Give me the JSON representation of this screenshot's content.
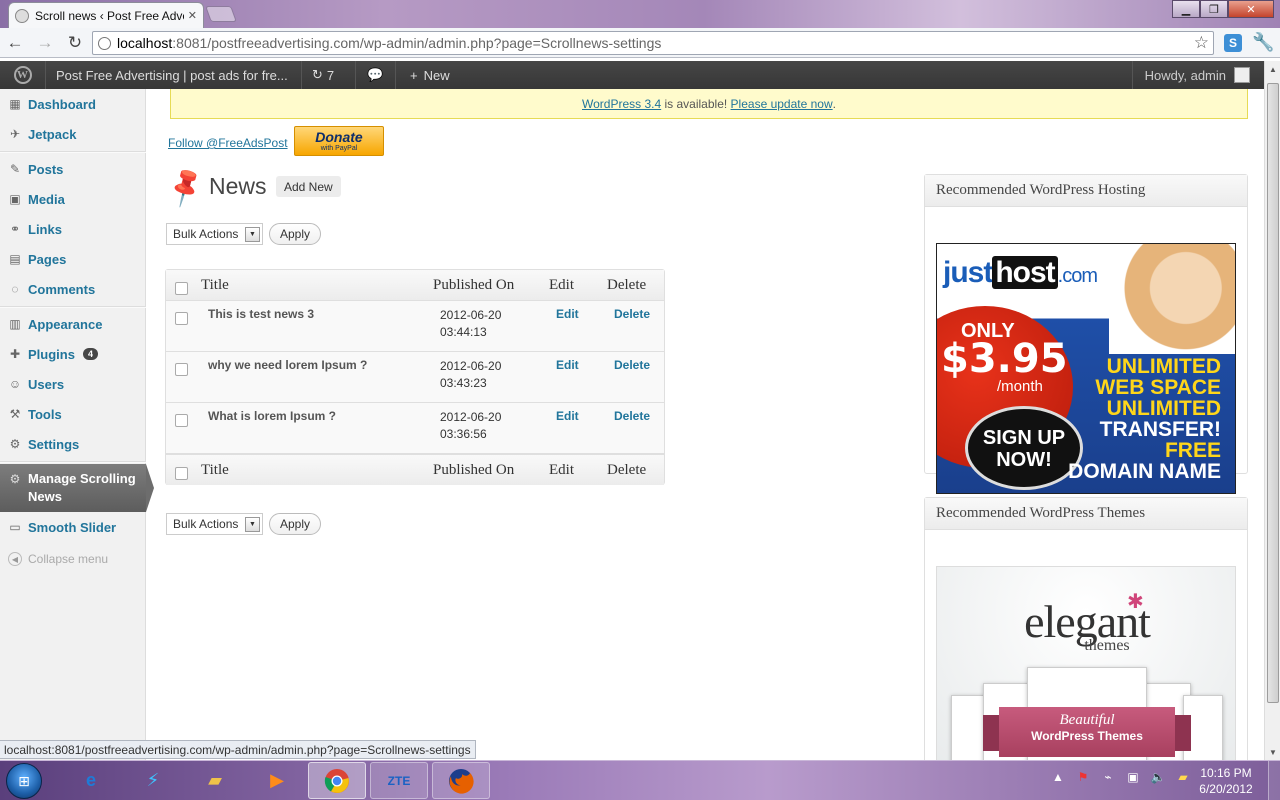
{
  "browser": {
    "tab_title": "Scroll news ‹ Post Free Adve",
    "url_host": "localhost",
    "url_rest": ":8081/postfreeadvertising.com/wp-admin/admin.php?page=Scrollnews-settings",
    "status_url": "localhost:8081/postfreeadvertising.com/wp-admin/admin.php?page=Scrollnews-settings"
  },
  "adminbar": {
    "site_name": "Post Free Advertising | post ads for fre...",
    "updates_count": "7",
    "new_label": "New",
    "howdy": "Howdy, admin"
  },
  "sidebar": {
    "dashboard": "Dashboard",
    "jetpack": "Jetpack",
    "posts": "Posts",
    "media": "Media",
    "links": "Links",
    "pages": "Pages",
    "comments": "Comments",
    "appearance": "Appearance",
    "plugins": "Plugins",
    "plugins_badge": "4",
    "users": "Users",
    "tools": "Tools",
    "settings": "Settings",
    "manage_scrolling": "Manage Scrolling News",
    "smooth_slider": "Smooth Slider",
    "collapse": "Collapse menu"
  },
  "notice": {
    "update_link": "WordPress 3.4",
    "middle": " is available! ",
    "please_update": "Please update now",
    "end": "."
  },
  "follow_link": "Follow @FreeAdsPost",
  "donate": {
    "line1": "Donate",
    "line2": "with PayPal"
  },
  "page": {
    "heading": "News",
    "add_new": "Add New"
  },
  "bulk": {
    "label": "Bulk Actions",
    "apply": "Apply"
  },
  "table": {
    "columns": {
      "title": "Title",
      "published": "Published On",
      "edit": "Edit",
      "delete": "Delete"
    },
    "rows": [
      {
        "title": "This is test news 3",
        "date": "2012-06-20",
        "time": "03:44:13",
        "edit": "Edit",
        "delete": "Delete"
      },
      {
        "title": "why we need lorem Ipsum ?",
        "date": "2012-06-20",
        "time": "03:43:23",
        "edit": "Edit",
        "delete": "Delete"
      },
      {
        "title": "What is lorem Ipsum ?",
        "date": "2012-06-20",
        "time": "03:36:56",
        "edit": "Edit",
        "delete": "Delete"
      }
    ]
  },
  "widgets": {
    "hosting": {
      "title": "Recommended WordPress Hosting",
      "brand_just": "just",
      "brand_host": "host",
      "brand_com": ".com",
      "only": "ONLY",
      "price": "$3.95",
      "per_month": "/month",
      "sign_up": "SIGN UP",
      "now": "NOW!",
      "unlimited1": "UNLIMITED",
      "web_space": "WEB SPACE",
      "unlimited2": "UNLIMITED",
      "transfer": "TRANSFER!",
      "free": "FREE",
      "domain_name": "DOMAIN NAME"
    },
    "themes": {
      "title": "Recommended WordPress Themes",
      "brand": "elegant",
      "sub": "themes",
      "ribbon1": "Beautiful",
      "ribbon2": "WordPress Themes"
    }
  },
  "taskbar": {
    "time": "10:16 PM",
    "date": "6/20/2012"
  }
}
